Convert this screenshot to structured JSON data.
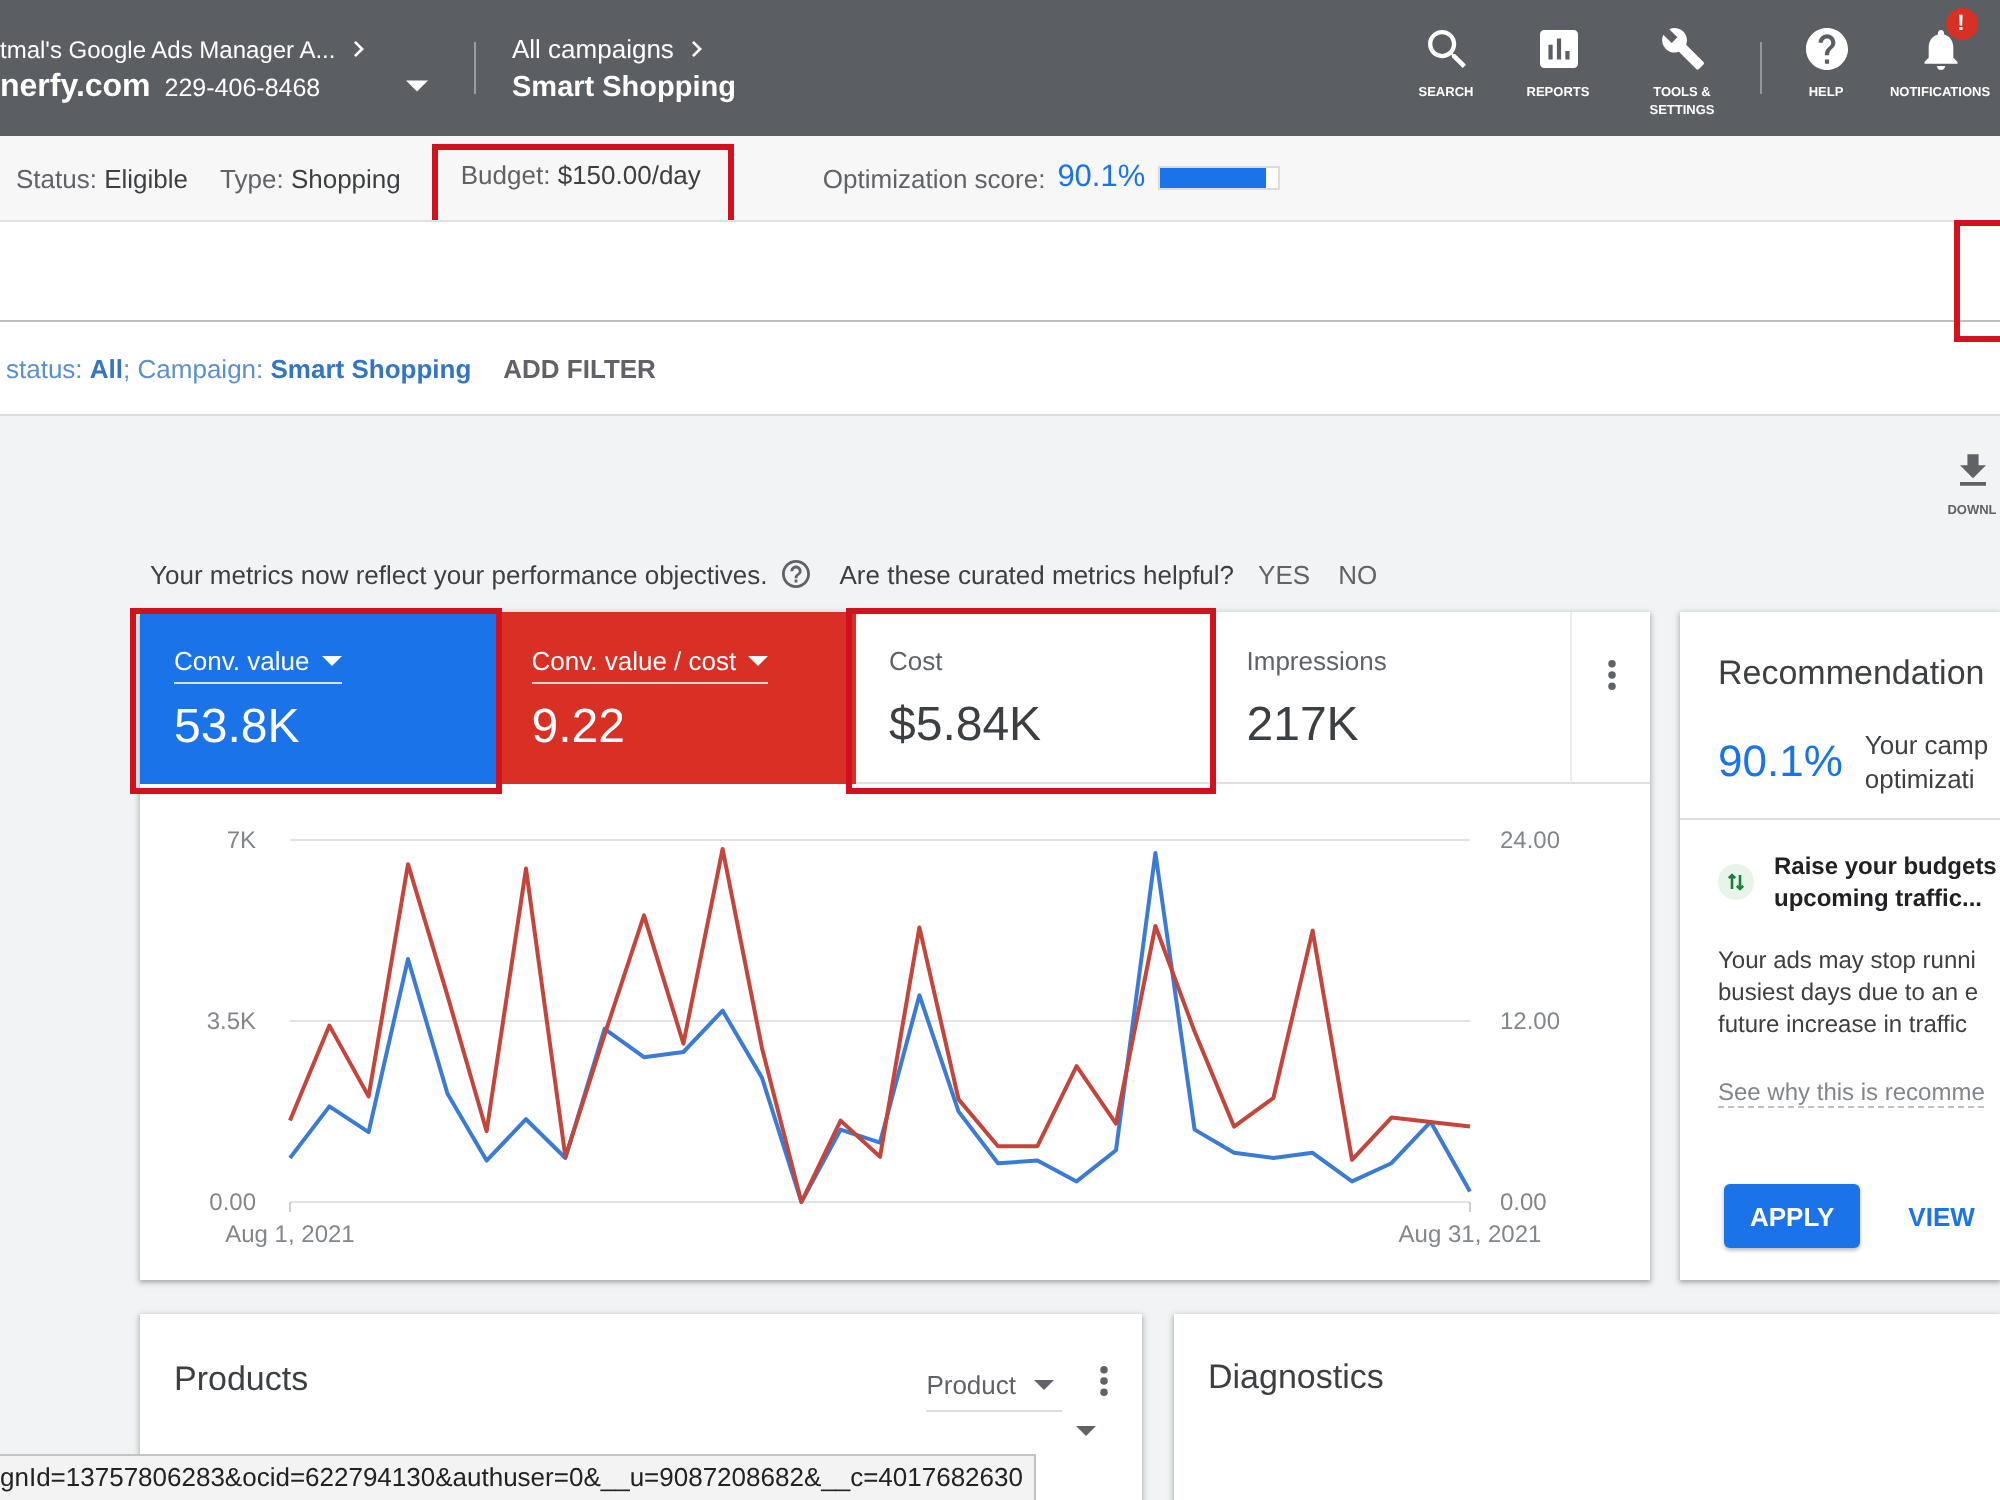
{
  "header": {
    "account": {
      "name": "tmal's Google Ads Manager A...",
      "domain": "nerfy.com",
      "phone": "229-406-8468"
    },
    "breadcrumb": {
      "parent": "All campaigns",
      "current": "Smart Shopping"
    },
    "tools": [
      {
        "kind": "search",
        "label": "SEARCH"
      },
      {
        "kind": "reports",
        "label": "REPORTS"
      },
      {
        "kind": "tools",
        "label": "TOOLS & SETTINGS"
      },
      {
        "kind": "help",
        "label": "HELP"
      },
      {
        "kind": "notifications",
        "label": "NOTIFICATIONS",
        "badge": "!"
      }
    ]
  },
  "status_bar": {
    "items": [
      {
        "label": "Status:",
        "value": "Eligible",
        "highlighted": false
      },
      {
        "label": "Type:",
        "value": "Shopping",
        "highlighted": false
      },
      {
        "label": "Budget:",
        "value": "$150.00/day",
        "highlighted": true
      }
    ],
    "optimization": {
      "label": "Optimization score:",
      "value": "90.1%",
      "level": 0.901
    }
  },
  "toolbar": {
    "highlighted": true
  },
  "filter": {
    "text": "status: **All**; Campaign: **Smart Shopping**",
    "add_label": "ADD FILTER"
  },
  "download": {
    "label": "DOWNL"
  },
  "notice": {
    "text": "Your metrics now reflect your performance objectives.",
    "question": "Are these curated metrics helpful?",
    "answers": [
      "YES",
      "NO"
    ]
  },
  "performance": {
    "metrics": [
      {
        "label": "Conv. value",
        "value": "53.8K",
        "selected": true,
        "color": "#1a73e8",
        "highlighted": true
      },
      {
        "label": "Conv. value / cost",
        "value": "9.22",
        "selected": true,
        "color": "#d93025",
        "highlighted": false
      },
      {
        "label": "Cost",
        "value": "$5.84K",
        "selected": false,
        "highlighted": true
      },
      {
        "label": "Impressions",
        "value": "217K",
        "selected": false,
        "highlighted": false
      }
    ],
    "chart_data": {
      "type": "line",
      "categories": [
        "Aug 1, 2021",
        null,
        null,
        null,
        null,
        null,
        null,
        null,
        null,
        null,
        null,
        null,
        null,
        null,
        null,
        null,
        null,
        null,
        null,
        null,
        null,
        null,
        null,
        null,
        null,
        null,
        null,
        null,
        null,
        null,
        "Aug 31, 2021"
      ],
      "ylim": [
        0,
        7000
      ],
      "yticks": [
        {
          "value": 0,
          "label": "0.00"
        },
        {
          "value": 3500,
          "label": "3.5K"
        },
        {
          "value": 7000,
          "label": "7K"
        }
      ],
      "y2lim": [
        0,
        24
      ],
      "y2ticks": [
        {
          "value": 0,
          "label": "0.00"
        },
        {
          "value": 12,
          "label": "12.00"
        },
        {
          "value": 24,
          "label": "24.00"
        }
      ],
      "series": [
        {
          "color": "#3b7bd4",
          "values": [
            850,
            1850,
            1350,
            4700,
            2100,
            800,
            1600,
            850,
            3350,
            2800,
            2900,
            3700,
            2400,
            0,
            1400,
            1150,
            4000,
            1750,
            750,
            800,
            400,
            1000,
            6750,
            1400,
            950,
            850,
            950,
            400,
            750,
            1550,
            200
          ]
        },
        {
          "color": "#c4453c",
          "axis": "y2",
          "values": [
            5.4,
            11.7,
            7,
            22.4,
            13.7,
            4.7,
            22.1,
            3,
            11.1,
            19,
            10.5,
            23.4,
            10.2,
            0,
            5.4,
            3,
            18.2,
            6.8,
            3.7,
            3.7,
            9,
            5.2,
            18.3,
            11.3,
            5,
            6.9,
            18,
            2.8,
            5.6,
            5.3,
            5
          ]
        }
      ]
    }
  },
  "recommendations": {
    "title": "Recommendation",
    "score": "90.1%",
    "score_text": [
      "Your camp",
      "optimizati"
    ],
    "item": {
      "title": [
        "Raise your budgets",
        "upcoming traffic..."
      ],
      "body": [
        "Your ads may stop runni",
        "busiest days due to an e",
        "future increase in traffic"
      ],
      "link": "See why this is recomme",
      "actions": [
        {
          "kind": "primary",
          "label": "APPLY"
        },
        {
          "kind": "text",
          "label": "VIEW"
        }
      ]
    }
  },
  "products": {
    "title": "Products",
    "dropdown": "Product"
  },
  "diagnostics": {
    "title": "Diagnostics"
  },
  "url_preview": "gnId=13757806283&ocid=622794130&authuser=0&__u=9087208682&__c=4017682630"
}
